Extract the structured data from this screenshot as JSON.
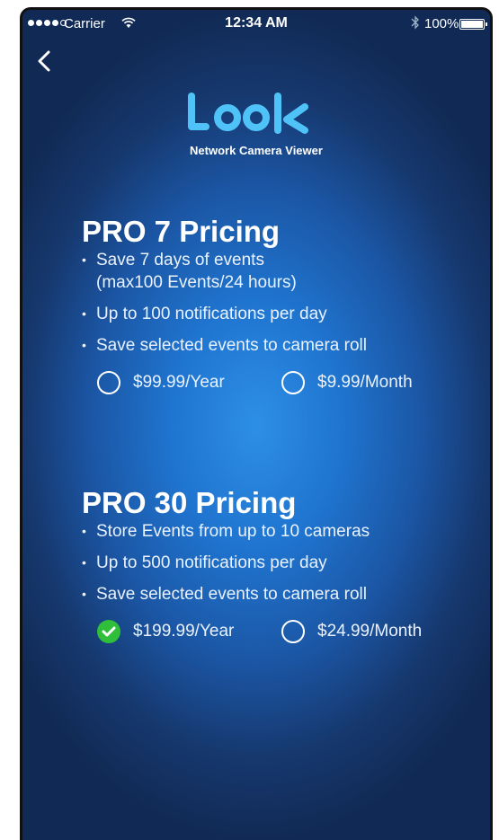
{
  "status_bar": {
    "carrier": "Carrier",
    "time": "12:34 AM",
    "battery": "100%"
  },
  "logo": {
    "text": "Look",
    "tagline": "Network Camera Viewer"
  },
  "plans": [
    {
      "title": "PRO 7 Pricing",
      "features": [
        "Save 7 days of events",
        "(max100 Events/24 hours)",
        "Up to 100 notifications per day",
        "Save selected events to camera roll"
      ],
      "options": [
        {
          "label": "$99.99/Year",
          "selected": false
        },
        {
          "label": "$9.99/Month",
          "selected": false
        }
      ]
    },
    {
      "title": "PRO 30 Pricing",
      "features": [
        "Store Events from up to 10 cameras",
        "Up to 500 notifications per day",
        "Save selected events to camera roll"
      ],
      "options": [
        {
          "label": "$199.99/Year",
          "selected": true
        },
        {
          "label": "$24.99/Month",
          "selected": false
        }
      ]
    }
  ],
  "colors": {
    "logo": "#4fc3f7",
    "selected": "#2fbf3a",
    "background": "#1f74cf"
  }
}
